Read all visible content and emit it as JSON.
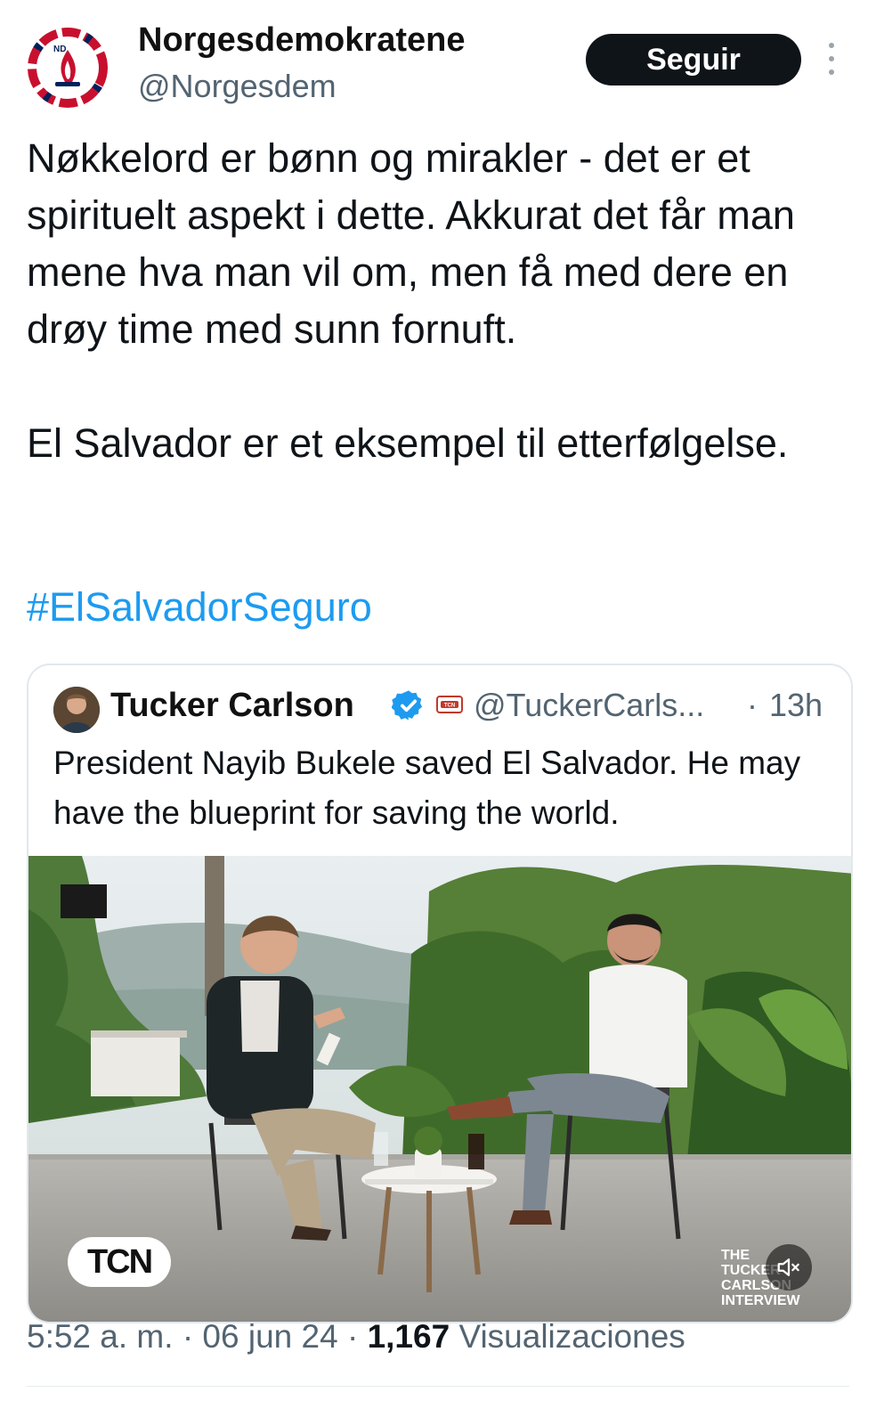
{
  "header": {
    "display_name": "Norgesdemokratene",
    "handle": "@Norgesdem",
    "follow_label": "Seguir",
    "avatar_initials": "ND"
  },
  "tweet": {
    "paragraph1": "Nøkkelord er bønn og mirakler - det er et spirituelt aspekt i dette. Akkurat det får man mene hva man vil om, men få med dere en drøy time med sunn fornuft.",
    "paragraph2": "El Salvador er et eksempel til etterfølgelse.",
    "hashtag": "#ElSalvadorSeguro"
  },
  "quoted": {
    "display_name": "Tucker Carlson",
    "handle": "@TuckerCarls...",
    "separator": "·",
    "time": "13h",
    "text": "President Nayib Bukele saved El Salvador. He may have the blueprint for saving the world.",
    "badge_text": "TCN",
    "media": {
      "logo": "TCN",
      "corner_text": [
        "THE",
        "TUCKER",
        "CARLSON",
        "INTERVIEW"
      ],
      "muted": true
    }
  },
  "footer": {
    "time": "5:52 a. m.",
    "sep1": "·",
    "date": "06 jun 24",
    "sep2": "·",
    "views": "1,167",
    "views_label": "Visualizaciones"
  },
  "colors": {
    "link": "#1d9bf0",
    "secondary": "#536471",
    "button_bg": "#0f1419",
    "verified": "#1d9bf0"
  }
}
